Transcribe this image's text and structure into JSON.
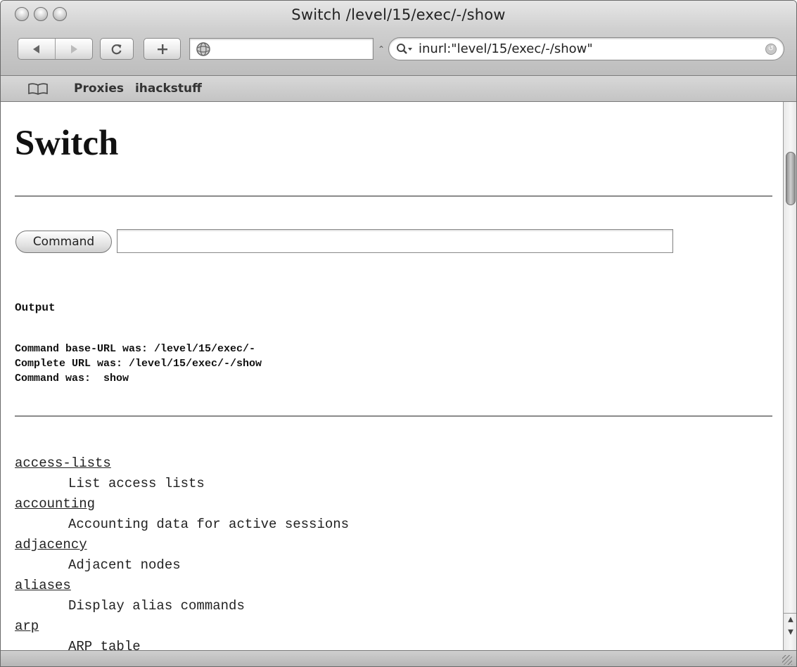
{
  "window": {
    "title": "Switch /level/15/exec/-/show"
  },
  "toolbar": {
    "back_icon": "back-arrow-icon",
    "forward_icon": "forward-arrow-icon",
    "reload_icon": "reload-icon",
    "add_bookmark_icon": "plus-icon",
    "address_value": "",
    "search_value": "inurl:\"level/15/exec/-/show\""
  },
  "bookmarks": {
    "items": [
      {
        "label": "Proxies"
      },
      {
        "label": "ihackstuff"
      }
    ]
  },
  "page": {
    "heading": "Switch",
    "command_button": "Command",
    "command_input_value": "",
    "output_heading": "Output",
    "output_lines": [
      "Command base-URL was: /level/15/exec/-",
      "Complete URL was: /level/15/exec/-/show",
      "Command was:  show"
    ],
    "commands": [
      {
        "name": "access-lists",
        "description": "List access lists"
      },
      {
        "name": "accounting",
        "description": "Accounting data for active sessions"
      },
      {
        "name": "adjacency",
        "description": "Adjacent nodes"
      },
      {
        "name": "aliases",
        "description": "Display alias commands"
      },
      {
        "name": "arp",
        "description": "ARP table"
      }
    ]
  }
}
